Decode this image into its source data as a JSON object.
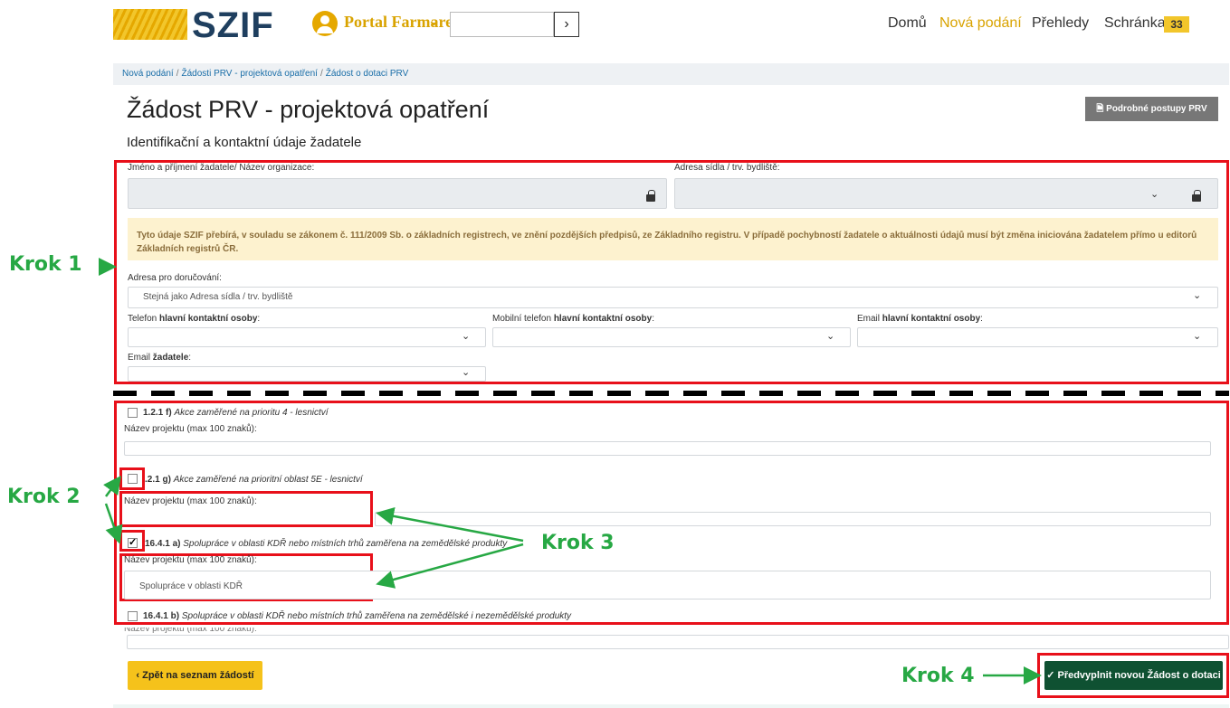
{
  "header": {
    "brand": "SZIF",
    "portal_label": "Portal Farmare",
    "nav": [
      "Domů",
      "Nová podání",
      "Přehledy",
      "Schránka"
    ],
    "inbox_count": "33",
    "subject_go": "›"
  },
  "breadcrumb": [
    "Nová podání",
    "Žádosti PRV - projektová opatření",
    "Žádost o dotaci PRV"
  ],
  "page_title": "Žádost PRV - projektová opatření",
  "guide_button": "Podrobné postupy PRV",
  "section_title": "Identifikační a kontaktní údaje žadatele",
  "applicant": {
    "name_label": "Jméno a příjmení žadatele/ Název organizace:",
    "address_label": "Adresa sídla / trv. bydliště:",
    "warning": "Tyto údaje SZIF přebírá, v souladu se zákonem č. 111/2009 Sb. o základních registrech, ve znění pozdějších předpisů, ze Základního registru. V případě pochybností žadatele o aktuálnosti údajů musí být změna iniciována žadatelem přímo u editorů Základních registrů ČR.",
    "delivery_label": "Adresa pro doručování:",
    "delivery_value": "Stejná jako Adresa sídla / trv. bydliště",
    "phone_label_pre": "Telefon ",
    "phone_label_bold": "hlavní kontaktní osoby",
    "mobile_label_pre": "Mobilní telefon ",
    "mobile_label_bold": "hlavní kontaktní osoby",
    "email_contact_pre": "Email ",
    "email_contact_bold": "hlavní kontaktní osoby",
    "email_applicant_pre": "Email ",
    "email_applicant_bold": "žadatele",
    "colon": ":"
  },
  "options": [
    {
      "code": "1.2.1 f)",
      "desc": "Akce zaměřené na prioritu 4 - lesnictví",
      "checked": false,
      "project_label": "Název projektu (max 100 znaků):",
      "project_value": ""
    },
    {
      "code": ".2.1 g)",
      "desc": "Akce zaměřené na prioritní oblast 5E - lesnictví",
      "checked": false,
      "project_label": "Název projektu (max 100 znaků):",
      "project_value": ""
    },
    {
      "code": "16.4.1 a)",
      "desc": "Spolupráce v oblasti KDŘ nebo místních trhů zaměřena na zemědělské produkty",
      "checked": true,
      "project_label": "Název projektu (max 100 znaků):",
      "project_value": "Spolupráce v oblasti KDŘ"
    },
    {
      "code": "16.4.1 b)",
      "desc": "Spolupráce v oblasti KDŘ nebo místních trhů zaměřena na zemědělské i nezemědělské produkty",
      "checked": false,
      "project_label": "Název projektu (max 100 znaků):",
      "project_value": ""
    }
  ],
  "steps": [
    "Krok 1",
    "Krok 2",
    "Krok 3",
    "Krok 4"
  ],
  "buttons": {
    "back": "‹ Zpět na seznam žádostí",
    "prefill": "✓ Předvyplnit novou Žádost o dotaci"
  },
  "colors": {
    "accent": "#d9a300",
    "annotation_red": "#e8101a",
    "annotation_green": "#27a844",
    "primary_green": "#0f5132"
  }
}
